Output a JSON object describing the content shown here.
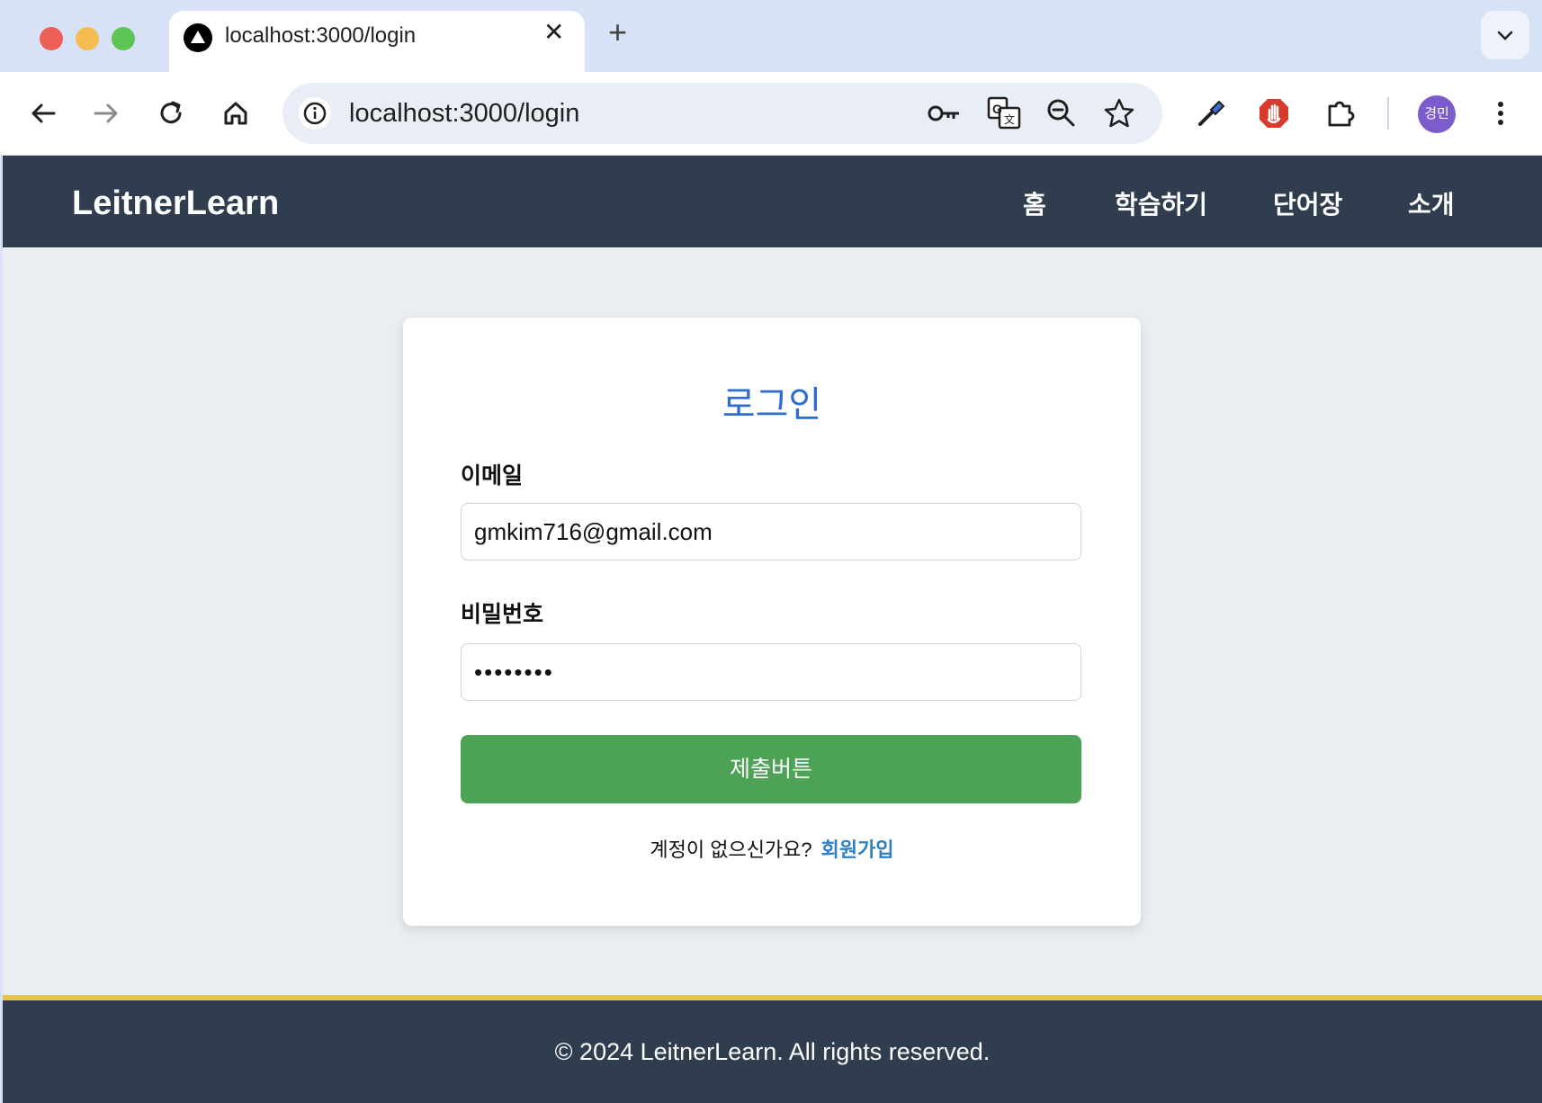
{
  "browser": {
    "tab_title": "localhost:3000/login",
    "tab_close": "✕",
    "new_tab": "+",
    "url": "localhost:3000/login",
    "profile_initials": "경민"
  },
  "navbar": {
    "brand": "LeitnerLearn",
    "links": [
      "홈",
      "학습하기",
      "단어장",
      "소개"
    ]
  },
  "login": {
    "title": "로그인",
    "email_label": "이메일",
    "email_value": "gmkim716@gmail.com",
    "password_label": "비밀번호",
    "password_value": "••••••••",
    "submit_label": "제출버튼",
    "no_account_text": "계정이 없으신가요?",
    "signup_link": "회원가입"
  },
  "footer": {
    "text": "© 2024 LeitnerLearn. All rights reserved."
  },
  "colors": {
    "navbar_bg": "#2f3d4f",
    "submit_bg": "#4ca356",
    "title_color": "#2e6ccd",
    "link_color": "#2f7fc1",
    "footer_border": "#e6c54a"
  }
}
